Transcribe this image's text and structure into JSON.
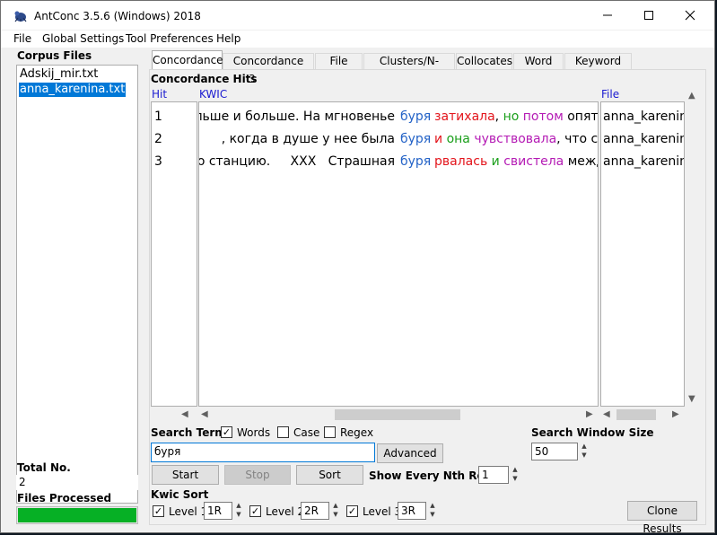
{
  "window": {
    "title": "AntConc 3.5.6 (Windows) 2018"
  },
  "menu": [
    "File",
    "Global Settings",
    "Tool Preferences",
    "Help"
  ],
  "corpus": {
    "label": "Corpus Files",
    "files": [
      "Adskij_mir.txt",
      "anna_karenina.txt"
    ],
    "selected_index": 1
  },
  "stats": {
    "total_label": "Total No.",
    "total_value": "2",
    "files_processed_label": "Files Processed",
    "progress": 1.0
  },
  "tabs": [
    "Concordance",
    "Concordance Plot",
    "File View",
    "Clusters/N-Grams",
    "Collocates",
    "Word List",
    "Keyword List"
  ],
  "active_tab": 0,
  "concordance": {
    "hits_label": "Concordance Hits",
    "hits_count": "3",
    "col_hit": "Hit",
    "col_kwic": "KWIC",
    "col_file": "File",
    "rows": [
      {
        "hit": "1",
        "left": "льше и больше. На мгновенье",
        "key": "буря",
        "right": [
          {
            "t": "затихала",
            "c": "red"
          },
          {
            "t": ",",
            "c": "blk"
          },
          {
            "t": "но",
            "c": "green"
          },
          {
            "t": "потом",
            "c": "mag"
          },
          {
            "t": "опять",
            "c": "blk"
          }
        ],
        "file": "anna_karenina"
      },
      {
        "hit": "2",
        "left": ", когда в душе у нее была",
        "key": "буря",
        "right": [
          {
            "t": "и",
            "c": "red"
          },
          {
            "t": "она",
            "c": "green"
          },
          {
            "t": "чувствовала",
            "c": "mag"
          },
          {
            "t": ", что стс",
            "c": "blk"
          }
        ],
        "file": "anna_karenina"
      },
      {
        "hit": "3",
        "left": "ю станцию.     XXX   Страшная",
        "key": "буря",
        "right": [
          {
            "t": "рвалась",
            "c": "red"
          },
          {
            "t": "и",
            "c": "green"
          },
          {
            "t": "свистела",
            "c": "mag"
          },
          {
            "t": "между",
            "c": "blk"
          }
        ],
        "file": "anna_karenina"
      }
    ]
  },
  "search": {
    "term_label": "Search Term",
    "words_label": "Words",
    "words_checked": true,
    "case_label": "Case",
    "case_checked": false,
    "regex_label": "Regex",
    "regex_checked": false,
    "term_value": "буря",
    "advanced_label": "Advanced",
    "start_label": "Start",
    "stop_label": "Stop",
    "sort_label": "Sort",
    "nth_label": "Show Every Nth Row",
    "nth_value": "1",
    "window_label": "Search Window Size",
    "window_value": "50"
  },
  "kwic_sort": {
    "label": "Kwic Sort",
    "levels": [
      {
        "label": "Level 1",
        "value": "1R",
        "checked": true
      },
      {
        "label": "Level 2",
        "value": "2R",
        "checked": true
      },
      {
        "label": "Level 3",
        "value": "3R",
        "checked": true
      }
    ]
  },
  "clone_label": "Clone Results",
  "colors": {
    "keyword": "#2463c7",
    "red": "#e3141b",
    "green": "#1a9f1a",
    "magenta": "#b41ab4",
    "selection": "#0078d7",
    "progress": "#06b025"
  }
}
